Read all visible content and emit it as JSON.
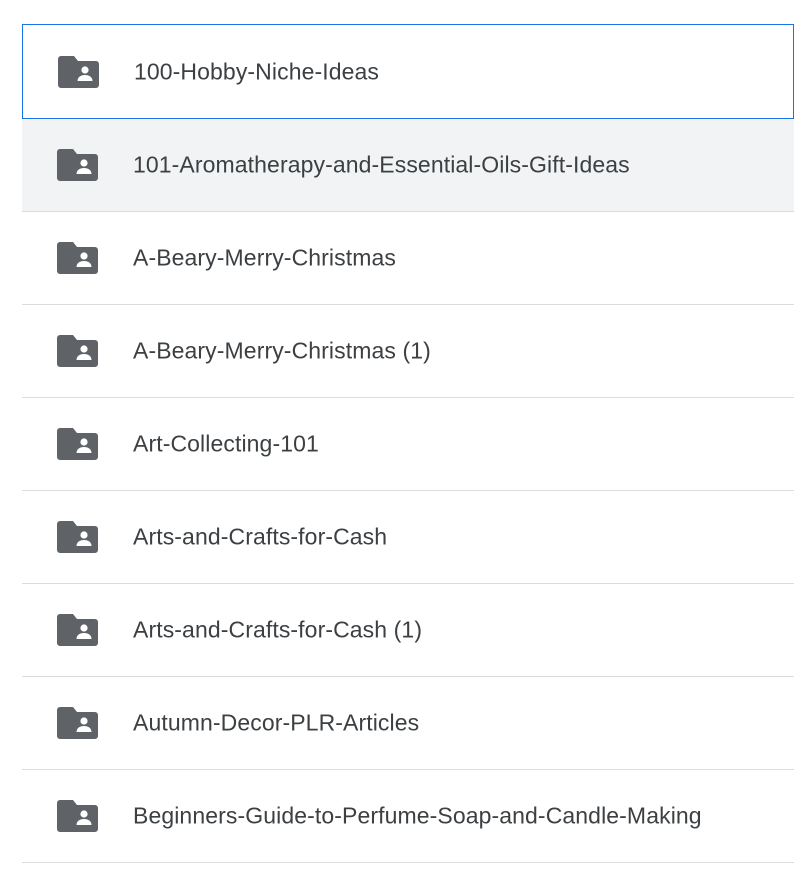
{
  "folders": [
    {
      "name": "100-Hobby-Niche-Ideas",
      "state": "selected"
    },
    {
      "name": "101-Aromatherapy-and-Essential-Oils-Gift-Ideas",
      "state": "hovered"
    },
    {
      "name": "A-Beary-Merry-Christmas",
      "state": "normal"
    },
    {
      "name": "A-Beary-Merry-Christmas (1)",
      "state": "normal"
    },
    {
      "name": "Art-Collecting-101",
      "state": "normal"
    },
    {
      "name": "Arts-and-Crafts-for-Cash",
      "state": "normal"
    },
    {
      "name": "Arts-and-Crafts-for-Cash (1)",
      "state": "normal"
    },
    {
      "name": "Autumn-Decor-PLR-Articles",
      "state": "normal"
    },
    {
      "name": "Beginners-Guide-to-Perfume-Soap-and-Candle-Making",
      "state": "normal"
    }
  ],
  "icon": "shared-folder-icon",
  "colors": {
    "icon": "#5f6368",
    "text": "#3c4043",
    "divider": "#dadce0",
    "selected_border": "#1a73e8",
    "hover_bg": "#f1f3f4"
  }
}
